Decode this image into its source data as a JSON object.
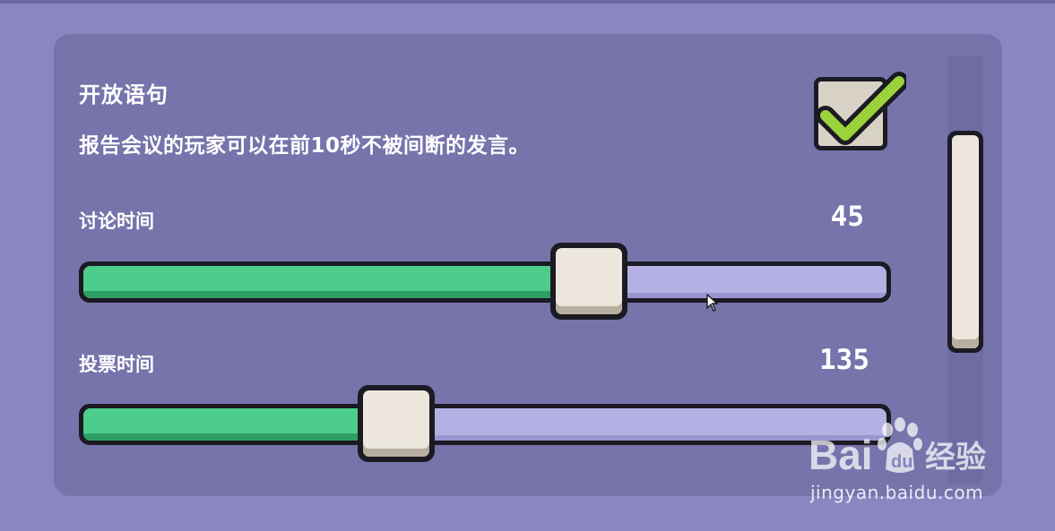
{
  "option": {
    "title": "开放语句",
    "description": "报告会议的玩家可以在前10秒不被间断的发言。",
    "checked": true
  },
  "sliders": [
    {
      "label": "讨论时间",
      "value": "45",
      "fill_fraction": 0.63
    },
    {
      "label": "投票时间",
      "value": "135",
      "fill_fraction": 0.39
    }
  ],
  "colors": {
    "background": "#8a86c2",
    "panel": "#7773ab",
    "fill": "#4ccd8b",
    "track": "#b5b0e3",
    "knob": "#ece6dd",
    "check": "#9bd33a"
  },
  "watermark": {
    "logo": "Baidu经验",
    "url": "jingyan.baidu.com"
  }
}
